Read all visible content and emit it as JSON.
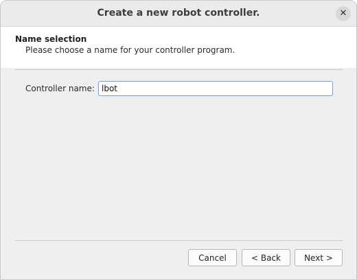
{
  "window": {
    "title": "Create a new robot controller.",
    "close_glyph": "✕"
  },
  "header": {
    "title": "Name selection",
    "description": "Please choose a name for your controller program."
  },
  "form": {
    "controller_name_label": "Controller name:",
    "controller_name_value": "lbot"
  },
  "buttons": {
    "cancel": "Cancel",
    "back": "< Back",
    "next": "Next >"
  },
  "colors": {
    "window_bg": "#efefef",
    "header_bg": "#ffffff",
    "input_focus_border": "#6f9fd0"
  },
  "icons": {
    "close": "close-icon"
  }
}
